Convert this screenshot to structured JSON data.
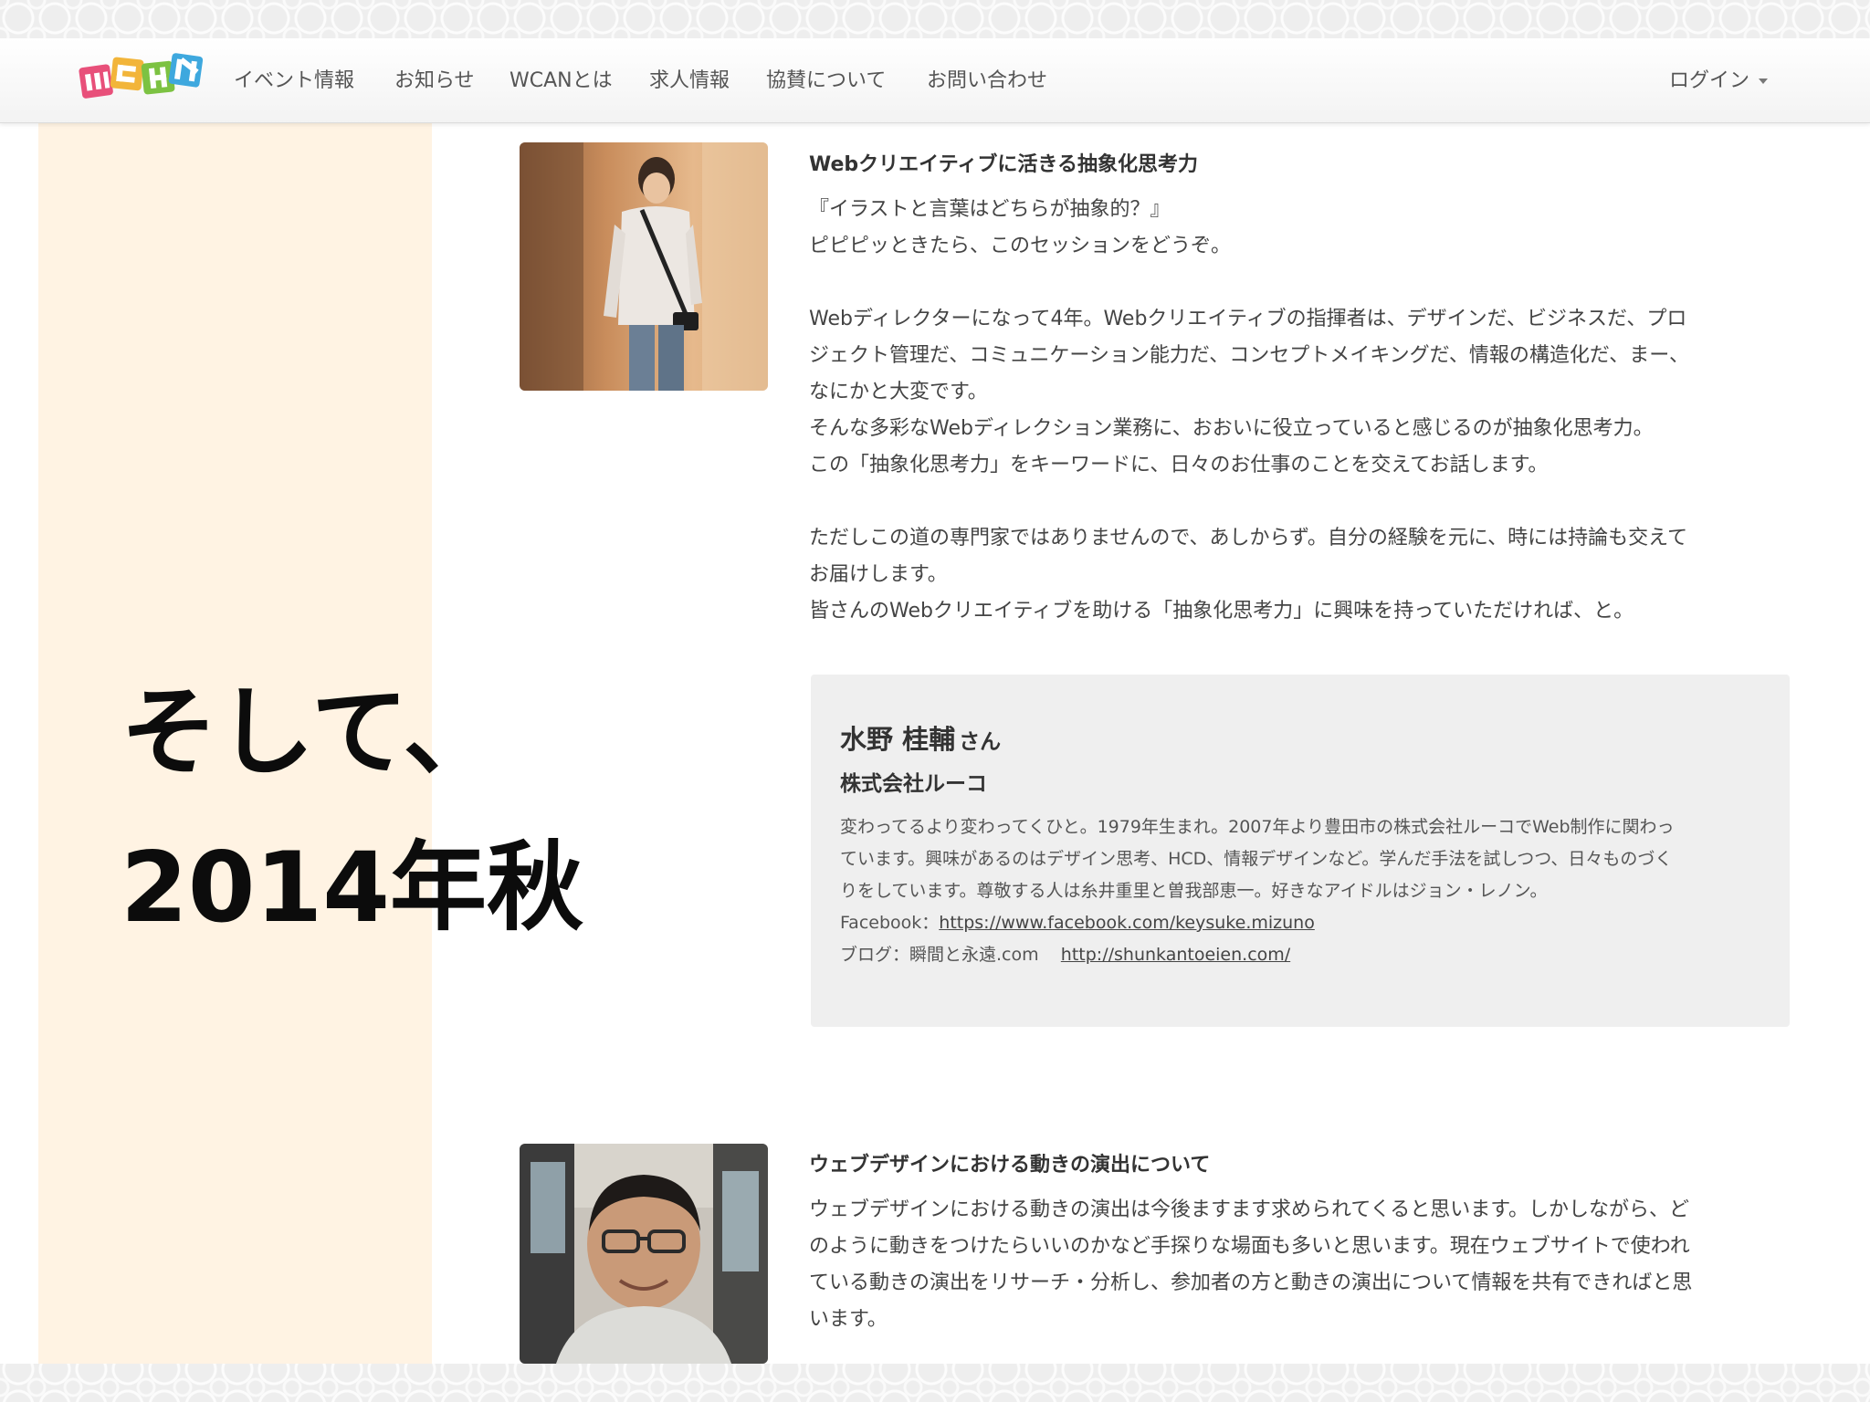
{
  "nav": {
    "items": [
      "イベント情報",
      "お知らせ",
      "WCANとは",
      "求人情報",
      "協賛について",
      "お問い合わせ"
    ],
    "login": "ログイン"
  },
  "overlay": {
    "line1": "そして、",
    "line2": "2014年秋"
  },
  "session1": {
    "title": "Webクリエイティブに活きる抽象化思考力",
    "paragraphs": [
      "『イラストと言葉はどちらが抽象的？』",
      "ピピピッときたら、このセッションをどうぞ。",
      "",
      "Webディレクターになって4年。Webクリエイティブの指揮者は、デザインだ、ビジネスだ、プロ",
      "ジェクト管理だ、コミュニケーション能力だ、コンセプトメイキングだ、情報の構造化だ、まー、",
      "なにかと大変です。",
      "そんな多彩なWebディレクション業務に、おおいに役立っていると感じるのが抽象化思考力。",
      "この「抽象化思考力」をキーワードに、日々のお仕事のことを交えてお話します。",
      "",
      "ただしこの道の専門家ではありませんので、あしからず。自分の経験を元に、時には持論も交えて",
      "お届けします。",
      "皆さんのWebクリエイティブを助ける「抽象化思考力」に興味を持っていただければ、と。"
    ]
  },
  "speaker": {
    "name": "水野 桂輔",
    "honorific": "さん",
    "company": "株式会社ルーコ",
    "bio_lines": [
      "変わってるより変わってくひと。1979年生まれ。2007年より豊田市の株式会社ルーコでWeb制作に関わっ",
      "ています。興味があるのはデザイン思考、HCD、情報デザインなど。学んだ手法を試しつつ、日々ものづく",
      "りをしています。尊敬する人は糸井重里と曽我部恵一。好きなアイドルはジョン・レノン。"
    ],
    "facebook_label": "Facebook：",
    "facebook_url": "https://www.facebook.com/keysuke.mizuno",
    "blog_label": "ブログ：瞬間と永遠.com",
    "blog_url": "http://shunkantoeien.com/"
  },
  "session2": {
    "title": "ウェブデザインにおける動きの演出について",
    "paragraphs": [
      "ウェブデザインにおける動きの演出は今後ますます求められてくると思います。しかしながら、ど",
      "のように動きをつけたらいいのかなど手探りな場面も多いと思います。現在ウェブサイトで使われ",
      "ている動きの演出をリサーチ・分析し、参加者の方と動きの演出について情報を共有できればと思",
      "います。"
    ]
  },
  "colors": {
    "left_panel": "#fff3e3",
    "speaker_box": "#efefef",
    "overlay_text": "#0c0c0c"
  }
}
